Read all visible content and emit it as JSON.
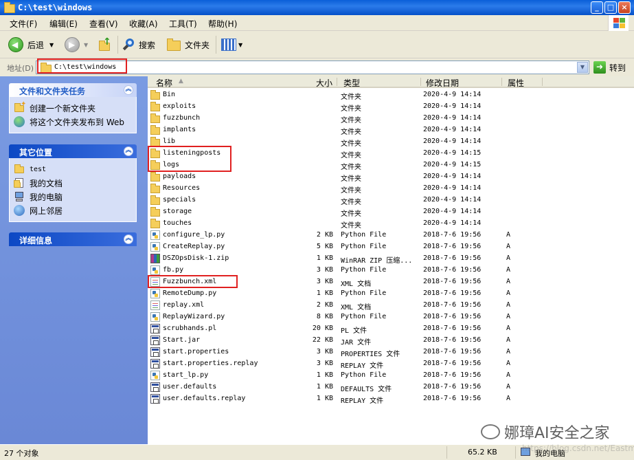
{
  "window": {
    "title": "C:\\test\\windows"
  },
  "menu": [
    "文件(F)",
    "编辑(E)",
    "查看(V)",
    "收藏(A)",
    "工具(T)",
    "帮助(H)"
  ],
  "toolbar": {
    "back": "后退",
    "search": "搜索",
    "folders": "文件夹"
  },
  "address": {
    "label": "地址(D)",
    "value": "C:\\test\\windows",
    "go": "转到"
  },
  "tasks_panel": {
    "title": "文件和文件夹任务",
    "items": [
      {
        "label": "创建一个新文件夹",
        "icon": "new-folder-icon"
      },
      {
        "label": "将这个文件夹发布到 Web",
        "icon": "web-publish-icon"
      }
    ]
  },
  "other_places": {
    "title": "其它位置",
    "items": [
      {
        "label": "test",
        "icon": "folder-icon"
      },
      {
        "label": "我的文档",
        "icon": "my-documents-icon"
      },
      {
        "label": "我的电脑",
        "icon": "my-computer-icon"
      },
      {
        "label": "网上邻居",
        "icon": "network-icon"
      }
    ]
  },
  "details_panel": {
    "title": "详细信息"
  },
  "columns": {
    "name": "名称",
    "size": "大小",
    "type": "类型",
    "modified": "修改日期",
    "attr": "属性"
  },
  "files": [
    {
      "name": "Bin",
      "size": "",
      "type": "文件夹",
      "date": "2020-4-9 14:14",
      "attr": "",
      "icon": "folder"
    },
    {
      "name": "exploits",
      "size": "",
      "type": "文件夹",
      "date": "2020-4-9 14:14",
      "attr": "",
      "icon": "folder"
    },
    {
      "name": "fuzzbunch",
      "size": "",
      "type": "文件夹",
      "date": "2020-4-9 14:14",
      "attr": "",
      "icon": "folder"
    },
    {
      "name": "implants",
      "size": "",
      "type": "文件夹",
      "date": "2020-4-9 14:14",
      "attr": "",
      "icon": "folder"
    },
    {
      "name": "lib",
      "size": "",
      "type": "文件夹",
      "date": "2020-4-9 14:14",
      "attr": "",
      "icon": "folder"
    },
    {
      "name": "listeningposts",
      "size": "",
      "type": "文件夹",
      "date": "2020-4-9 14:15",
      "attr": "",
      "icon": "folder"
    },
    {
      "name": "logs",
      "size": "",
      "type": "文件夹",
      "date": "2020-4-9 14:15",
      "attr": "",
      "icon": "folder"
    },
    {
      "name": "payloads",
      "size": "",
      "type": "文件夹",
      "date": "2020-4-9 14:14",
      "attr": "",
      "icon": "folder"
    },
    {
      "name": "Resources",
      "size": "",
      "type": "文件夹",
      "date": "2020-4-9 14:14",
      "attr": "",
      "icon": "folder"
    },
    {
      "name": "specials",
      "size": "",
      "type": "文件夹",
      "date": "2020-4-9 14:14",
      "attr": "",
      "icon": "folder"
    },
    {
      "name": "storage",
      "size": "",
      "type": "文件夹",
      "date": "2020-4-9 14:14",
      "attr": "",
      "icon": "folder"
    },
    {
      "name": "touches",
      "size": "",
      "type": "文件夹",
      "date": "2020-4-9 14:14",
      "attr": "",
      "icon": "folder"
    },
    {
      "name": "configure_lp.py",
      "size": "2 KB",
      "type": "Python File",
      "date": "2018-7-6 19:56",
      "attr": "A",
      "icon": "py"
    },
    {
      "name": "CreateReplay.py",
      "size": "5 KB",
      "type": "Python File",
      "date": "2018-7-6 19:56",
      "attr": "A",
      "icon": "py"
    },
    {
      "name": "DSZOpsDisk-1.zip",
      "size": "1 KB",
      "type": "WinRAR ZIP 压缩...",
      "date": "2018-7-6 19:56",
      "attr": "A",
      "icon": "zip"
    },
    {
      "name": "fb.py",
      "size": "3 KB",
      "type": "Python File",
      "date": "2018-7-6 19:56",
      "attr": "A",
      "icon": "py"
    },
    {
      "name": "Fuzzbunch.xml",
      "size": "3 KB",
      "type": "XML 文档",
      "date": "2018-7-6 19:56",
      "attr": "A",
      "icon": "xml"
    },
    {
      "name": "RemoteDump.py",
      "size": "1 KB",
      "type": "Python File",
      "date": "2018-7-6 19:56",
      "attr": "A",
      "icon": "py"
    },
    {
      "name": "replay.xml",
      "size": "2 KB",
      "type": "XML 文档",
      "date": "2018-7-6 19:56",
      "attr": "A",
      "icon": "xml"
    },
    {
      "name": "ReplayWizard.py",
      "size": "8 KB",
      "type": "Python File",
      "date": "2018-7-6 19:56",
      "attr": "A",
      "icon": "py"
    },
    {
      "name": "scrubhands.pl",
      "size": "20 KB",
      "type": "PL 文件",
      "date": "2018-7-6 19:56",
      "attr": "A",
      "icon": "gen"
    },
    {
      "name": "Start.jar",
      "size": "22 KB",
      "type": "JAR 文件",
      "date": "2018-7-6 19:56",
      "attr": "A",
      "icon": "gen"
    },
    {
      "name": "start.properties",
      "size": "3 KB",
      "type": "PROPERTIES 文件",
      "date": "2018-7-6 19:56",
      "attr": "A",
      "icon": "gen"
    },
    {
      "name": "start.properties.replay",
      "size": "3 KB",
      "type": "REPLAY 文件",
      "date": "2018-7-6 19:56",
      "attr": "A",
      "icon": "gen"
    },
    {
      "name": "start_lp.py",
      "size": "1 KB",
      "type": "Python File",
      "date": "2018-7-6 19:56",
      "attr": "A",
      "icon": "py"
    },
    {
      "name": "user.defaults",
      "size": "1 KB",
      "type": "DEFAULTS 文件",
      "date": "2018-7-6 19:56",
      "attr": "A",
      "icon": "gen"
    },
    {
      "name": "user.defaults.replay",
      "size": "1 KB",
      "type": "REPLAY 文件",
      "date": "2018-7-6 19:56",
      "attr": "A",
      "icon": "gen"
    }
  ],
  "status": {
    "count": "27 个对象",
    "size": "65.2 KB",
    "location": "我的电脑"
  },
  "watermark": {
    "text": "娜璋AI安全之家",
    "sub": "https://blog.csdn.net/Eastmount"
  },
  "colors": {
    "xp_blue": "#0A5FD8",
    "pane_blue": "#6A88D6",
    "highlight_red": "#E02020"
  }
}
